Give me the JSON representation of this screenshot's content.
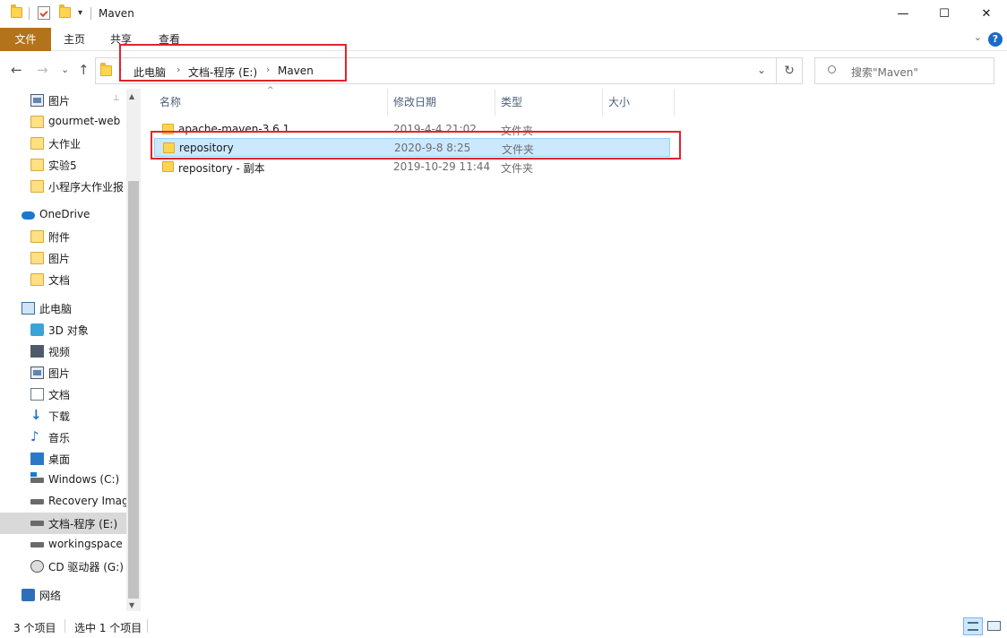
{
  "window": {
    "title": "Maven",
    "minimize": "—",
    "maximize": "☐",
    "close": "✕"
  },
  "ribbon": {
    "tabs": [
      "文件",
      "主页",
      "共享",
      "查看"
    ],
    "help": "?",
    "expand": "⌄"
  },
  "address": {
    "back": "←",
    "forward": "→",
    "recent": "⌄",
    "up": "↑",
    "crumbs": [
      "此电脑",
      "文档-程序 (E:)",
      "Maven"
    ],
    "separator": "›",
    "dropdown": "⌄",
    "refresh": "↻",
    "search_placeholder": "搜索\"Maven\""
  },
  "nav": {
    "pin": "📌",
    "items": [
      {
        "label": "图片",
        "icon": "pictures-icon",
        "kind": "pic",
        "pinned": true
      },
      {
        "label": "gourmet-web",
        "icon": "folder-icon",
        "kind": "folder"
      },
      {
        "label": "大作业",
        "icon": "folder-icon",
        "kind": "folder"
      },
      {
        "label": "实验5",
        "icon": "folder-icon",
        "kind": "folder"
      },
      {
        "label": "小程序大作业报",
        "icon": "folder-icon",
        "kind": "folder"
      },
      {
        "label": "OneDrive",
        "icon": "cloud-icon",
        "kind": "cloud"
      },
      {
        "label": "附件",
        "icon": "folder-icon",
        "kind": "folder"
      },
      {
        "label": "图片",
        "icon": "folder-icon",
        "kind": "folder"
      },
      {
        "label": "文档",
        "icon": "folder-icon",
        "kind": "folder"
      },
      {
        "label": "此电脑",
        "icon": "computer-icon",
        "kind": "pc"
      },
      {
        "label": "3D 对象",
        "icon": "3d-objects-icon",
        "kind": "3d"
      },
      {
        "label": "视频",
        "icon": "video-icon",
        "kind": "video"
      },
      {
        "label": "图片",
        "icon": "pictures-icon",
        "kind": "pic"
      },
      {
        "label": "文档",
        "icon": "documents-icon",
        "kind": "doc"
      },
      {
        "label": "下载",
        "icon": "download-icon",
        "kind": "download"
      },
      {
        "label": "音乐",
        "icon": "music-icon",
        "kind": "music"
      },
      {
        "label": "桌面",
        "icon": "desktop-icon",
        "kind": "desk"
      },
      {
        "label": "Windows (C:)",
        "icon": "windows-drive-icon",
        "kind": "windrive"
      },
      {
        "label": "Recovery Imag",
        "icon": "drive-icon",
        "kind": "drive"
      },
      {
        "label": "文档-程序 (E:)",
        "icon": "drive-icon",
        "kind": "drive",
        "selected": true
      },
      {
        "label": "workingspace",
        "icon": "drive-icon",
        "kind": "drive"
      },
      {
        "label": "CD 驱动器 (G:)",
        "icon": "cd-drive-icon",
        "kind": "cd"
      },
      {
        "label": "网络",
        "icon": "network-icon",
        "kind": "net"
      }
    ]
  },
  "columns": {
    "name": "名称",
    "date": "修改日期",
    "type": "类型",
    "size": "大小",
    "sort": "^"
  },
  "files": [
    {
      "name": "apache-maven-3.6.1",
      "date": "2019-4-4 21:02",
      "type": "文件夹"
    },
    {
      "name": "repository",
      "date": "2020-9-8 8:25",
      "type": "文件夹",
      "selected": true
    },
    {
      "name": "repository - 副本",
      "date": "2019-10-29 11:44",
      "type": "文件夹"
    }
  ],
  "status": {
    "count": "3 个项目",
    "selected": "选中 1 个项目"
  },
  "colors": {
    "file_tab": "#b3731a",
    "selection": "#cce8ff",
    "annotation": "#e0242a"
  }
}
